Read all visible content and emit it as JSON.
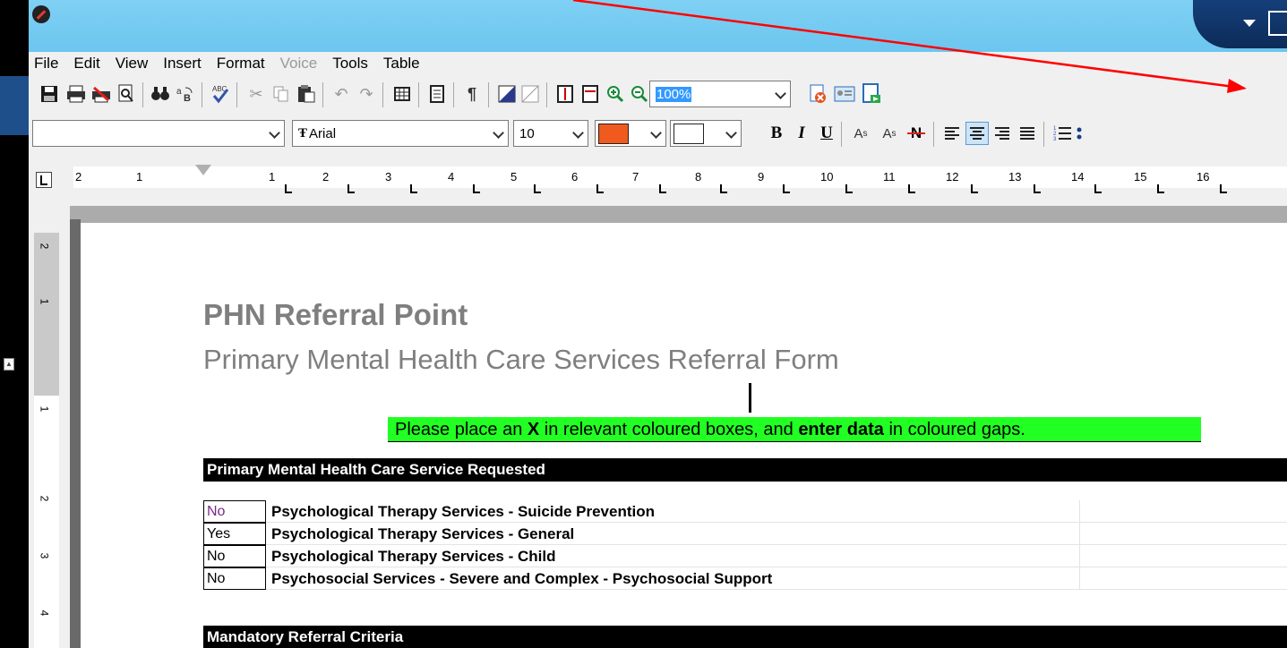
{
  "menu": {
    "items": [
      {
        "label": "File",
        "enabled": true
      },
      {
        "label": "Edit",
        "enabled": true
      },
      {
        "label": "View",
        "enabled": true
      },
      {
        "label": "Insert",
        "enabled": true
      },
      {
        "label": "Format",
        "enabled": true
      },
      {
        "label": "Voice",
        "enabled": false
      },
      {
        "label": "Tools",
        "enabled": true
      },
      {
        "label": "Table",
        "enabled": true
      }
    ]
  },
  "toolbar": {
    "zoom_value": "100%",
    "style_value": "",
    "font_value": "Arial",
    "size_value": "10",
    "font_color": "#f05a1e",
    "highlight_color": "#ffffff",
    "bold_label": "B",
    "italic_label": "I",
    "underline_label": "U",
    "subscript_label": "A",
    "superscript_label": "A",
    "strike_label": "N"
  },
  "ruler": {
    "labels": [
      "2",
      "1",
      "1",
      "2",
      "3",
      "4",
      "5",
      "6",
      "7",
      "8",
      "9",
      "10",
      "11",
      "12",
      "13",
      "14",
      "15",
      "16"
    ]
  },
  "vruler": {
    "labels": [
      "2",
      "1",
      "1",
      "2",
      "3",
      "4"
    ]
  },
  "document": {
    "title": "PHN Referral Point",
    "subtitle": "Primary Mental Health Care Services Referral Form",
    "instruction_part1": "Please place an ",
    "instruction_x": "X",
    "instruction_part2": " in relevant coloured boxes, and ",
    "instruction_enter": "enter data",
    "instruction_part3": " in coloured gaps.",
    "section1_header": "Primary Mental Health Care Service Requested",
    "services": [
      {
        "answer": "No",
        "label": "Psychological Therapy Services - Suicide Prevention"
      },
      {
        "answer": "Yes",
        "label": "Psychological Therapy Services - General"
      },
      {
        "answer": "No",
        "label": "Psychological Therapy Services - Child"
      },
      {
        "answer": "No",
        "label": "Psychosocial Services - Severe and Complex - Psychosocial Support"
      }
    ],
    "section2_header": "Mandatory Referral Criteria"
  },
  "colors": {
    "titlebar": "#6cc6ef",
    "instruction_bg": "#22ff22",
    "annotation_arrow": "#ff0000"
  }
}
